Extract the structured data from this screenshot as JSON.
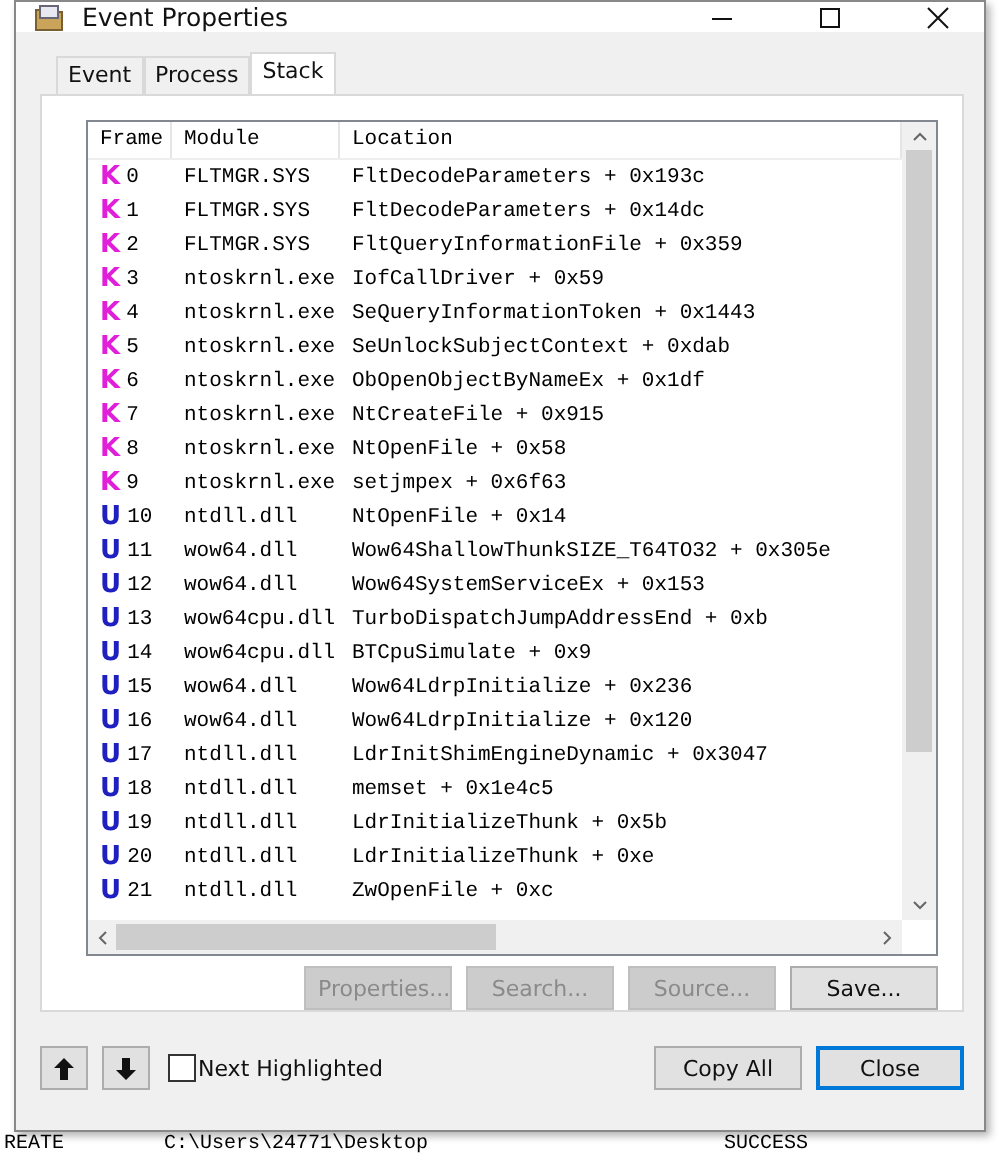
{
  "window": {
    "title": "Event Properties"
  },
  "tabs": [
    {
      "label": "Event",
      "selected": false
    },
    {
      "label": "Process",
      "selected": false
    },
    {
      "label": "Stack",
      "selected": true
    }
  ],
  "table": {
    "columns": [
      "Frame",
      "Module",
      "Location"
    ],
    "rows": [
      {
        "color": "#e020d8",
        "badge": "K",
        "frame": "0",
        "module": "FLTMGR.SYS",
        "location": "FltDecodeParameters + 0x193c"
      },
      {
        "color": "#e020d8",
        "badge": "K",
        "frame": "1",
        "module": "FLTMGR.SYS",
        "location": "FltDecodeParameters + 0x14dc"
      },
      {
        "color": "#e020d8",
        "badge": "K",
        "frame": "2",
        "module": "FLTMGR.SYS",
        "location": "FltQueryInformationFile + 0x359"
      },
      {
        "color": "#e020d8",
        "badge": "K",
        "frame": "3",
        "module": "ntoskrnl.exe",
        "location": "IofCallDriver + 0x59"
      },
      {
        "color": "#e020d8",
        "badge": "K",
        "frame": "4",
        "module": "ntoskrnl.exe",
        "location": "SeQueryInformationToken + 0x1443"
      },
      {
        "color": "#e020d8",
        "badge": "K",
        "frame": "5",
        "module": "ntoskrnl.exe",
        "location": "SeUnlockSubjectContext + 0xdab"
      },
      {
        "color": "#e020d8",
        "badge": "K",
        "frame": "6",
        "module": "ntoskrnl.exe",
        "location": "ObOpenObjectByNameEx + 0x1df"
      },
      {
        "color": "#e020d8",
        "badge": "K",
        "frame": "7",
        "module": "ntoskrnl.exe",
        "location": "NtCreateFile + 0x915"
      },
      {
        "color": "#e020d8",
        "badge": "K",
        "frame": "8",
        "module": "ntoskrnl.exe",
        "location": "NtOpenFile + 0x58"
      },
      {
        "color": "#e020d8",
        "badge": "K",
        "frame": "9",
        "module": "ntoskrnl.exe",
        "location": "setjmpex + 0x6f63"
      },
      {
        "color": "#2020c0",
        "badge": "U",
        "frame": "10",
        "module": "ntdll.dll",
        "location": "NtOpenFile + 0x14"
      },
      {
        "color": "#2020c0",
        "badge": "U",
        "frame": "11",
        "module": "wow64.dll",
        "location": "Wow64ShallowThunkSIZE_T64TO32 + 0x305e"
      },
      {
        "color": "#2020c0",
        "badge": "U",
        "frame": "12",
        "module": "wow64.dll",
        "location": "Wow64SystemServiceEx + 0x153"
      },
      {
        "color": "#2020c0",
        "badge": "U",
        "frame": "13",
        "module": "wow64cpu.dll",
        "location": "TurboDispatchJumpAddressEnd + 0xb"
      },
      {
        "color": "#2020c0",
        "badge": "U",
        "frame": "14",
        "module": "wow64cpu.dll",
        "location": "BTCpuSimulate + 0x9"
      },
      {
        "color": "#2020c0",
        "badge": "U",
        "frame": "15",
        "module": "wow64.dll",
        "location": "Wow64LdrpInitialize + 0x236"
      },
      {
        "color": "#2020c0",
        "badge": "U",
        "frame": "16",
        "module": "wow64.dll",
        "location": "Wow64LdrpInitialize + 0x120"
      },
      {
        "color": "#2020c0",
        "badge": "U",
        "frame": "17",
        "module": "ntdll.dll",
        "location": "LdrInitShimEngineDynamic + 0x3047"
      },
      {
        "color": "#2020c0",
        "badge": "U",
        "frame": "18",
        "module": "ntdll.dll",
        "location": "memset + 0x1e4c5"
      },
      {
        "color": "#2020c0",
        "badge": "U",
        "frame": "19",
        "module": "ntdll.dll",
        "location": "LdrInitializeThunk + 0x5b"
      },
      {
        "color": "#2020c0",
        "badge": "U",
        "frame": "20",
        "module": "ntdll.dll",
        "location": "LdrInitializeThunk + 0xe"
      },
      {
        "color": "#2020c0",
        "badge": "U",
        "frame": "21",
        "module": "ntdll.dll",
        "location": "ZwOpenFile + 0xc"
      }
    ]
  },
  "panel_buttons": [
    {
      "label": "Properties...",
      "disabled": true
    },
    {
      "label": "Search...",
      "disabled": true
    },
    {
      "label": "Source...",
      "disabled": true
    },
    {
      "label": "Save...",
      "disabled": false
    }
  ],
  "next_highlighted": {
    "label": "Next Highlighted",
    "checked": false
  },
  "footer_buttons": [
    {
      "label": "Copy All",
      "default": false
    },
    {
      "label": "Close",
      "default": true
    }
  ],
  "background_row": [
    "REATE",
    "C:\\Users\\24771\\Desktop",
    "SUCCESS"
  ]
}
